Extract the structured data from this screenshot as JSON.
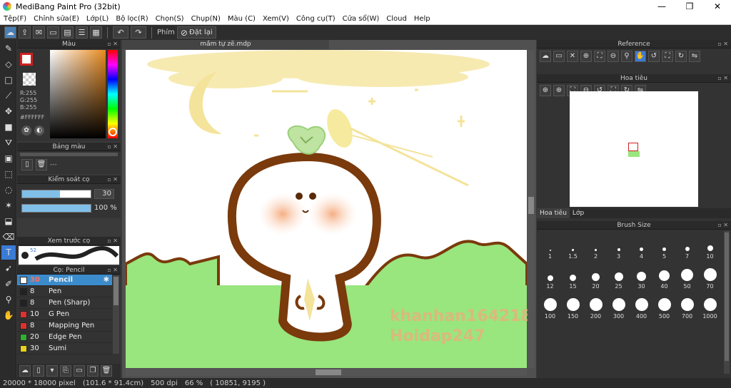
{
  "window": {
    "title": "MediBang Paint Pro (32bit)",
    "minimize": "—",
    "maximize": "❐",
    "close": "✕"
  },
  "menu": [
    "Tệp(F)",
    "Chỉnh sửa(E)",
    "Lớp(L)",
    "Bộ lọc(R)",
    "Chọn(S)",
    "Chụp(N)",
    "Màu (C)",
    "Xem(V)",
    "Công cụ(T)",
    "Cửa sổ(W)",
    "Cloud",
    "Help"
  ],
  "toolbar": {
    "phim_label": "Phím",
    "reset_label": "Đặt lại"
  },
  "color_panel": {
    "title": "Màu",
    "r": "R:255",
    "g": "G:255",
    "b": "B:255",
    "hex": "#FFFFFF"
  },
  "palette_panel": {
    "title": "Bảng màu",
    "dash": "---"
  },
  "brush_control": {
    "title": "Kiểm soát cọ",
    "size_value": "30",
    "opacity_value": "100",
    "opacity_unit": "%",
    "size_fraction": 0.55,
    "opacity_fraction": 1.0
  },
  "brush_preview": {
    "title": "Xem trước cọ",
    "size_label": "52"
  },
  "brush_list": {
    "title": "Cọ: Pencil",
    "items": [
      {
        "size": "30",
        "name": "Pencil",
        "color": "#ffffff",
        "selected": true
      },
      {
        "size": "8",
        "name": "Pen",
        "color": "#222222"
      },
      {
        "size": "8",
        "name": "Pen (Sharp)",
        "color": "#222222"
      },
      {
        "size": "10",
        "name": "G Pen",
        "color": "#e03030"
      },
      {
        "size": "8",
        "name": "Mapping Pen",
        "color": "#e03030"
      },
      {
        "size": "20",
        "name": "Edge Pen",
        "color": "#30b030"
      },
      {
        "size": "30",
        "name": "Sumi",
        "color": "#e8d020"
      }
    ]
  },
  "document": {
    "tab_title": "mầm tự zẽ.mdp",
    "watermark_1": "khanhan164218",
    "watermark_2": "Hoidap247"
  },
  "reference_panel": {
    "title": "Reference"
  },
  "navigator_panel": {
    "title": "Hoa tiêu",
    "tab_1": "Hoa tiêu",
    "tab_2": "Lớp"
  },
  "brush_size_panel": {
    "title": "Brush Size",
    "sizes": [
      "1",
      "1.5",
      "2",
      "3",
      "4",
      "5",
      "7",
      "10",
      "12",
      "15",
      "20",
      "25",
      "30",
      "40",
      "50",
      "70",
      "100",
      "150",
      "200",
      "300",
      "400",
      "500",
      "700",
      "1000"
    ]
  },
  "status": {
    "dimensions": "20000 * 18000 pixel",
    "physical": "(101.6 * 91.4cm)",
    "dpi": "500 dpi",
    "zoom": "66 %",
    "coords": "( 10851, 9195 )"
  },
  "colors": {
    "accent": "#3a7bd5",
    "grass": "#99e57e",
    "outline": "#7a3a0c",
    "blush": "#f6b98e",
    "moon": "#f6e7a4"
  }
}
